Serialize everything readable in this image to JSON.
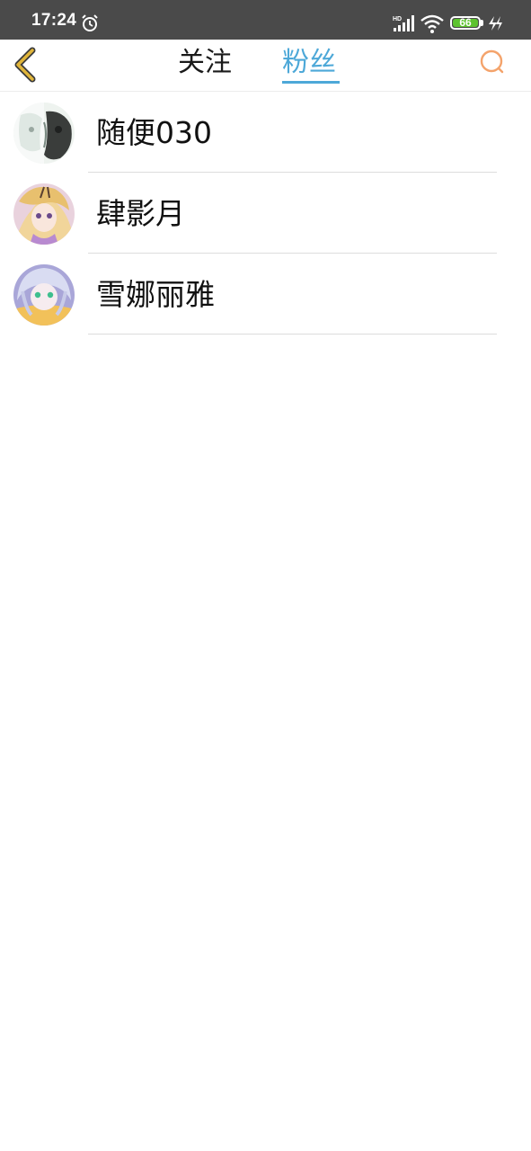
{
  "status_bar": {
    "time": "17:24",
    "icons": [
      "alarm-icon",
      "hd-signal-icon",
      "wifi-icon",
      "battery-icon",
      "charging-icon"
    ],
    "battery_level": "66",
    "network_label": "HD",
    "colors": {
      "background": "#4a4a4a",
      "battery": "#5dc32e"
    }
  },
  "header": {
    "back_icon": "chevron-left-icon",
    "tabs": [
      {
        "label": "关注",
        "active": false
      },
      {
        "label": "粉丝",
        "active": true
      }
    ],
    "search_icon": "search-icon",
    "colors": {
      "active_tab": "#4da8d8",
      "back": "#e0b53a",
      "search": "#f4a36b"
    }
  },
  "fans": [
    {
      "name": "随便030",
      "avatar": "avatar-bw-pattern"
    },
    {
      "name": "肆影月",
      "avatar": "avatar-anime-blonde-girl"
    },
    {
      "name": "雪娜丽雅",
      "avatar": "avatar-anime-silver-hair"
    }
  ]
}
